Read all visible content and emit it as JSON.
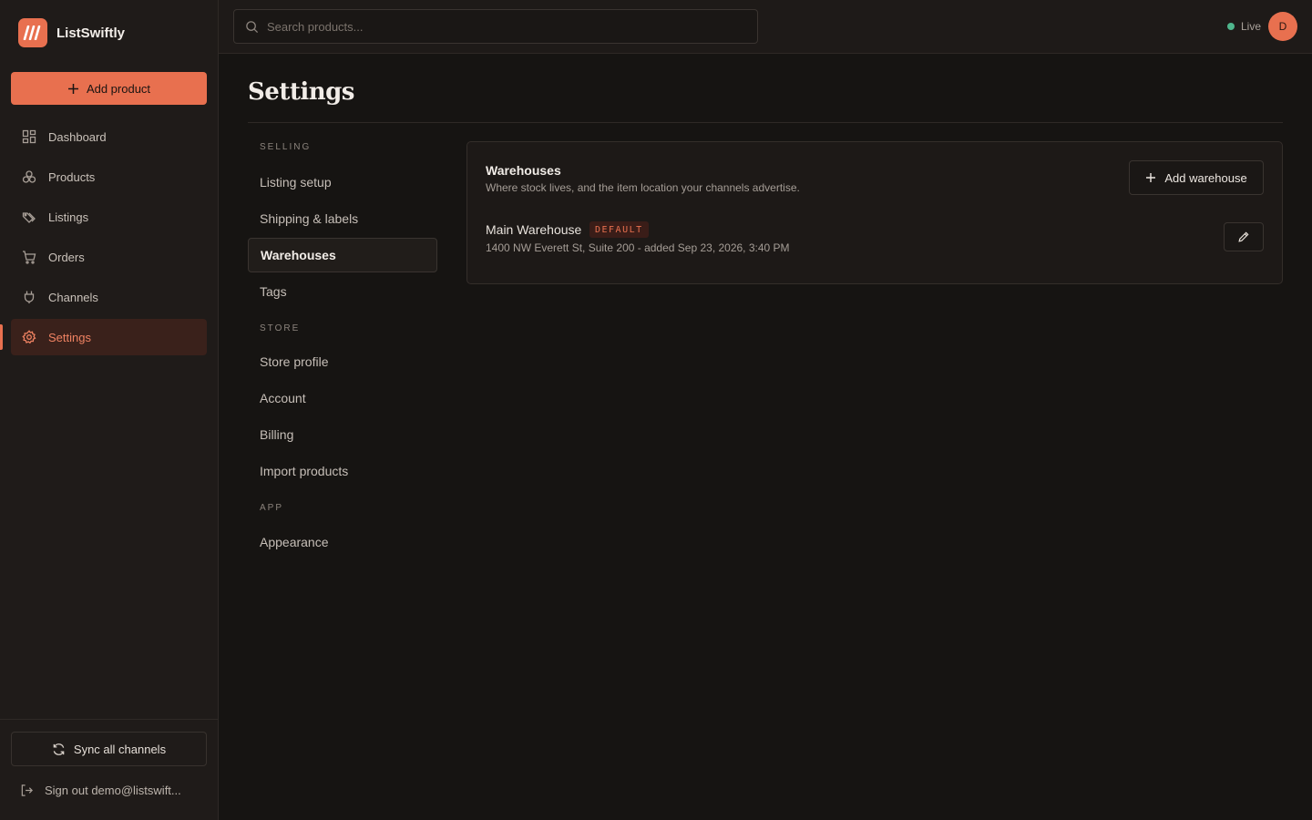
{
  "brand": {
    "name": "ListSwiftly"
  },
  "sidebar": {
    "add_product_label": "Add product",
    "items": [
      {
        "label": "Dashboard",
        "icon": "grid-icon",
        "active": false
      },
      {
        "label": "Products",
        "icon": "boxes-icon",
        "active": false
      },
      {
        "label": "Listings",
        "icon": "tag-icon",
        "active": false
      },
      {
        "label": "Orders",
        "icon": "cart-icon",
        "active": false
      },
      {
        "label": "Channels",
        "icon": "plug-icon",
        "active": false
      },
      {
        "label": "Settings",
        "icon": "gear-icon",
        "active": true
      }
    ],
    "sync_label": "Sync all channels",
    "signout_label": "Sign out demo@listswift..."
  },
  "topbar": {
    "search_placeholder": "Search products...",
    "status_label": "Live",
    "avatar_initial": "D"
  },
  "page": {
    "title": "Settings"
  },
  "settings_nav": {
    "groups": [
      {
        "label": "SELLING",
        "items": [
          "Listing setup",
          "Shipping & labels",
          "Warehouses",
          "Tags"
        ]
      },
      {
        "label": "STORE",
        "items": [
          "Store profile",
          "Account",
          "Billing",
          "Import products"
        ]
      },
      {
        "label": "APP",
        "items": [
          "Appearance"
        ]
      }
    ],
    "active_item": "Warehouses"
  },
  "warehouses": {
    "title": "Warehouses",
    "description": "Where stock lives, and the item location your channels advertise.",
    "add_label": "Add warehouse",
    "items": [
      {
        "name": "Main Warehouse",
        "badge": "DEFAULT",
        "meta": "1400 NW Everett St, Suite 200 - added Sep 23, 2026, 3:40 PM"
      }
    ]
  },
  "colors": {
    "accent": "#e8704f",
    "background": "#161412",
    "sidebar": "#1f1b19",
    "live": "#4fb58c"
  }
}
